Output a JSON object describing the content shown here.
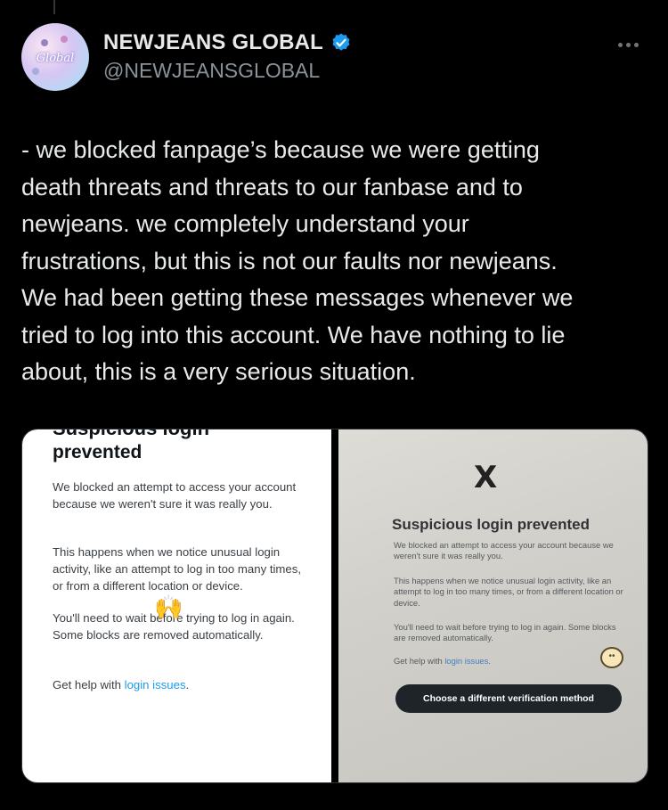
{
  "tweet": {
    "display_name": "NEWJEANS GLOBAL",
    "handle": "@NEWJEANSGLOBAL",
    "avatar_text": "Global",
    "text": "- we blocked fanpage’s because we were getting\ndeath threats and threats to our fanbase and to\nnewjeans. we completely understand your\nfrustrations, but this is not our faults nor newjeans.\nWe had been getting these messages whenever we\ntried to log into this account. We have nothing to lie\nabout, this is a very serious situation."
  },
  "media_left": {
    "cut_title": "Suspicious login",
    "title": "prevented",
    "p1": "We blocked an attempt to access your account because we weren't sure it was really you.",
    "p2": "This happens when we notice unusual login activity, like an attempt to log in too many times, or from a different location or device.",
    "p3": "You'll need to wait before trying to log in again. Some blocks are removed automatically.",
    "help_prefix": "Get help with ",
    "help_link": "login issues",
    "help_suffix": "."
  },
  "media_right": {
    "logo": "X",
    "title": "Suspicious login prevented",
    "p1": "We blocked an attempt to access your account because we weren't sure it was really you.",
    "p2": "This happens when we notice unusual login activity, like an attempt to log in too many times, or from a different location or device.",
    "p3": "You'll need to wait before trying to log in again. Some blocks are removed automatically.",
    "help_prefix": "Get help with ",
    "help_link": "login issues",
    "help_suffix": ".",
    "button_label": "Choose a different verification method"
  },
  "icons": {
    "verified": "verified-badge-icon",
    "more": "more-options-icon",
    "hands": "raised-hands-emoji",
    "sticker": "pompompurin-sticker"
  },
  "colors": {
    "background": "#000000",
    "text": "#e7e9ea",
    "handle": "#8b9298",
    "verified": "#1d9bf0",
    "link": "#1d9bf0"
  }
}
